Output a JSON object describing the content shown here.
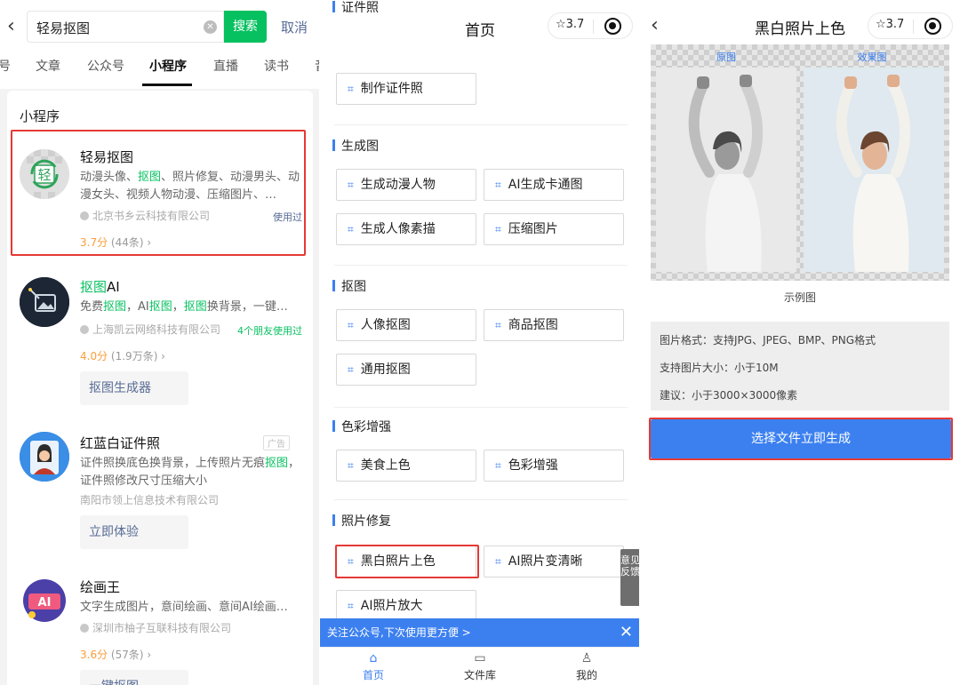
{
  "search": {
    "back": "‹",
    "query": "轻易抠图",
    "clear": "✕",
    "button": "搜索",
    "cancel": "取消"
  },
  "tabs": [
    "号",
    "文章",
    "公众号",
    "小程序",
    "直播",
    "读书",
    "音"
  ],
  "results": {
    "title": "小程序",
    "apps": [
      {
        "name": "轻易抠图",
        "desc_parts": [
          "动漫头像、",
          "抠图",
          "、照片修复、动漫男头、动漫女头、视频人物动漫、压缩图片、…"
        ],
        "company": "北京书乡云科技有限公司",
        "used": "使用过",
        "score": "3.7分",
        "reviews": "(44条) ›"
      },
      {
        "name_parts": [
          "抠图",
          "AI"
        ],
        "desc_parts": [
          "免费",
          "抠图",
          "，AI",
          "抠图",
          "，",
          "抠图",
          "换背景，一键…"
        ],
        "company": "上海凯云网络科技有限公司",
        "used": "4个朋友使用过",
        "score": "4.0分",
        "reviews": "(1.9万条) ›",
        "action": "抠图生成器"
      },
      {
        "name": "红蓝白证件照",
        "ad": "广告",
        "desc_parts": [
          "证件照换底色换背景，上传照片无痕",
          "抠图",
          "，证件照修改尺寸压缩大小"
        ],
        "company": "南阳市领上信息技术有限公司",
        "action": "立即体验"
      },
      {
        "name": "绘画王",
        "desc": "文字生成图片，意间绘画、意间AI绘画…",
        "company": "深圳市柚子互联科技有限公司",
        "score": "3.6分",
        "reviews": "(57条) ›",
        "action": "一键抠图"
      }
    ]
  },
  "home": {
    "title": "首页",
    "capsule_rating": "☆3.7",
    "sections": [
      {
        "title": "证件照",
        "buttons": [
          "制作证件照"
        ]
      },
      {
        "title": "生成图",
        "buttons": [
          "生成动漫人物",
          "AI生成卡通图",
          "生成人像素描",
          "压缩图片"
        ]
      },
      {
        "title": "抠图",
        "buttons": [
          "人像抠图",
          "商品抠图",
          "通用抠图"
        ]
      },
      {
        "title": "色彩增强",
        "buttons": [
          "美食上色",
          "色彩增强"
        ]
      },
      {
        "title": "照片修复",
        "buttons": [
          "黑白照片上色",
          "AI照片变清晰",
          "AI照片放大"
        ]
      }
    ],
    "feedback": "意见反馈",
    "follow_banner": "关注公众号,下次使用更方便 >",
    "follow_close": "✕",
    "tabbar": [
      {
        "label": "首页",
        "icon": "home-icon"
      },
      {
        "label": "文件库",
        "icon": "folder-icon"
      },
      {
        "label": "我的",
        "icon": "user-icon"
      }
    ]
  },
  "detail": {
    "back": "‹",
    "title": "黑白照片上色",
    "capsule_rating": "☆3.7",
    "original_label": "原图",
    "effect_label": "效果图",
    "example_label": "示例图",
    "info": [
      "图片格式：支持JPG、JPEG、BMP、PNG格式",
      "支持图片大小：小于10M",
      "建议：小于3000×3000像素"
    ],
    "generate_button": "选择文件立即生成"
  },
  "colors": {
    "wechat_green": "#07c160",
    "link_blue": "#576b95",
    "accent_blue": "#3c80f0",
    "highlight_red": "#e53935",
    "rating_orange": "#fa9d3b"
  }
}
